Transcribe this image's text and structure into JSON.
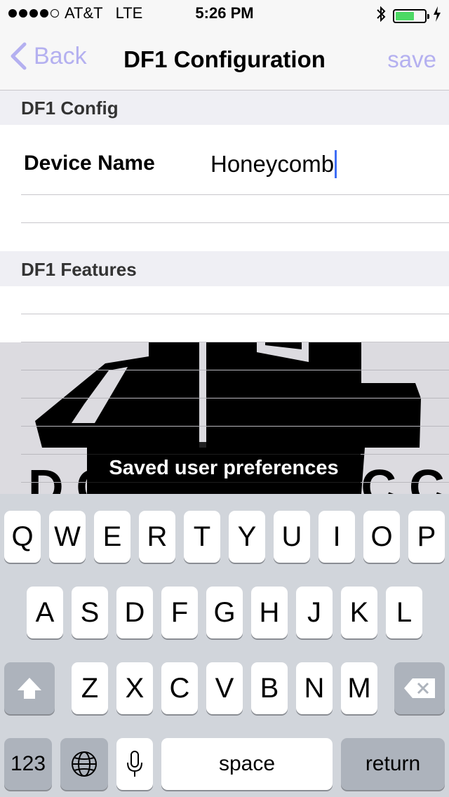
{
  "status_bar": {
    "carrier": "AT&T",
    "network": "LTE",
    "time": "5:26 PM"
  },
  "nav": {
    "back_label": "Back",
    "title": "DF1 Configuration",
    "save_label": "save"
  },
  "sections": {
    "config_header": "DF1 Config",
    "features_header": "DF1 Features"
  },
  "device_name": {
    "label": "Device Name",
    "value": "Honeycomb"
  },
  "toast": "Saved user preferences",
  "keyboard": {
    "row1": [
      "Q",
      "W",
      "E",
      "R",
      "T",
      "Y",
      "U",
      "I",
      "O",
      "P"
    ],
    "row2": [
      "A",
      "S",
      "D",
      "F",
      "G",
      "H",
      "J",
      "K",
      "L"
    ],
    "row3": [
      "Z",
      "X",
      "C",
      "V",
      "B",
      "N",
      "M"
    ],
    "numbers_label": "123",
    "space_label": "space",
    "return_label": "return"
  },
  "colors": {
    "accent": "#b4b0f0",
    "battery": "#4cd964",
    "caret": "#3f6ef5"
  }
}
